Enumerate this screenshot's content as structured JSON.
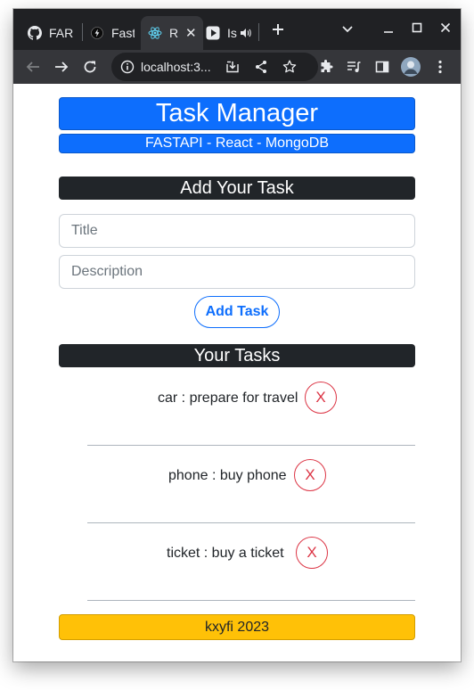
{
  "browser": {
    "tabs": [
      {
        "label": "FAR",
        "icon": "github-icon",
        "active": false
      },
      {
        "label": "Fast",
        "icon": "fastapi-icon",
        "active": false
      },
      {
        "label": "R",
        "icon": "react-icon",
        "active": true
      },
      {
        "label": "Is",
        "icon": "play-icon",
        "active": false
      }
    ],
    "address": "localhost:3..."
  },
  "app": {
    "title": "Task Manager",
    "subtitle": "FASTAPI - React - MongoDB",
    "add_heading": "Add Your Task",
    "title_placeholder": "Title",
    "description_placeholder": "Description",
    "add_button": "Add Task",
    "tasks_heading": "Your Tasks",
    "tasks": [
      {
        "text": "car : prepare for travel",
        "delete_label": "X"
      },
      {
        "text": "phone : buy phone",
        "delete_label": "X"
      },
      {
        "text": "ticket : buy a ticket",
        "delete_label": "X"
      }
    ],
    "footer": "kxyfi 2023"
  },
  "colors": {
    "primary": "#0d6efd",
    "dark": "#212529",
    "danger": "#dc3545",
    "warning": "#ffc107",
    "chrome_dark": "#202124",
    "chrome_toolbar": "#35363a"
  }
}
